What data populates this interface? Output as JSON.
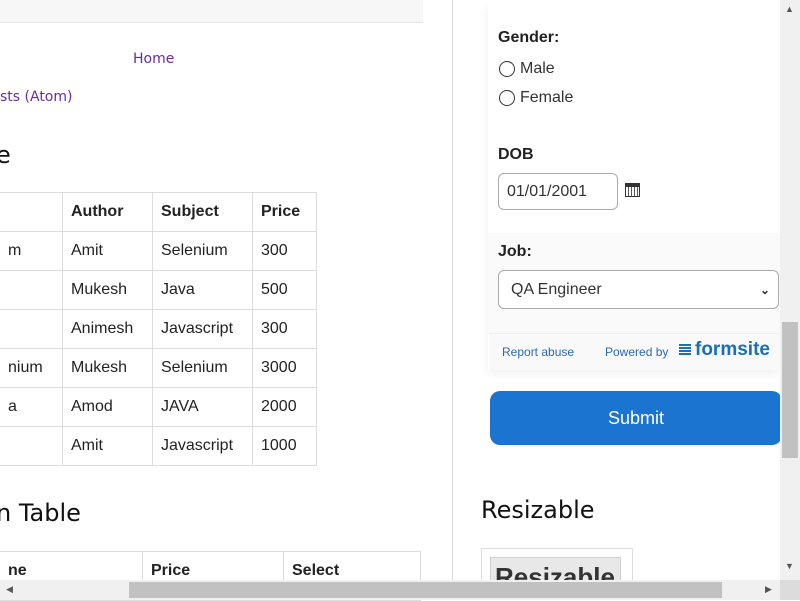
{
  "nav": {
    "home": "Home",
    "posts_atom": "sts (Atom)"
  },
  "table1": {
    "title": "e",
    "headers": [
      "",
      "Author",
      "Subject",
      "Price"
    ],
    "rows": [
      [
        "m",
        "Amit",
        "Selenium",
        "300"
      ],
      [
        "",
        "Mukesh",
        "Java",
        "500"
      ],
      [
        "",
        "Animesh",
        "Javascript",
        "300"
      ],
      [
        "nium",
        "Mukesh",
        "Selenium",
        "3000"
      ],
      [
        "a",
        "Amod",
        "JAVA",
        "2000"
      ],
      [
        "",
        "Amit",
        "Javascript",
        "1000"
      ]
    ]
  },
  "table2": {
    "title": "n Table",
    "headers": [
      "ne",
      "Price",
      "Select"
    ]
  },
  "form": {
    "gender_label": "Gender:",
    "gender_options": [
      "Male",
      "Female"
    ],
    "dob_label": "DOB",
    "dob_value": "01/01/2001",
    "job_label": "Job:",
    "job_value": "QA Engineer",
    "report_abuse": "Report abuse",
    "powered_by": "Powered by",
    "brand": "formsite",
    "submit": "Submit",
    "accent": "#1b75d0"
  },
  "resizable": {
    "title": "Resizable",
    "box_text": "Resizable"
  }
}
